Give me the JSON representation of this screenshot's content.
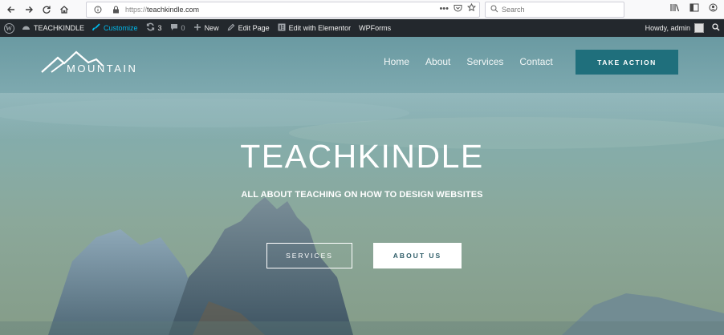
{
  "browser": {
    "url_protocol": "https://",
    "url_host": "teachkindle.com",
    "search_placeholder": "Search",
    "dots": "•••"
  },
  "wp_admin": {
    "site_name": "TEACHKINDLE",
    "customize": "Customize",
    "updates_count": "3",
    "comments_count": "0",
    "new_label": "New",
    "edit_page": "Edit Page",
    "edit_elementor": "Edit with Elementor",
    "wpforms": "WPForms",
    "howdy": "Howdy, admin"
  },
  "site": {
    "logo_text": "MOUNTAIN",
    "nav": [
      "Home",
      "About",
      "Services",
      "Contact"
    ],
    "cta": "TAKE ACTION",
    "hero_title": "TEACHKINDLE",
    "hero_subtitle": "ALL ABOUT TEACHING ON HOW TO DESIGN WEBSITES",
    "btn_services": "SERVICES",
    "btn_about": "ABOUT US"
  },
  "colors": {
    "cta_bg": "#1f6f7c",
    "wp_bar": "#23282d",
    "customize_accent": "#00b9eb"
  }
}
